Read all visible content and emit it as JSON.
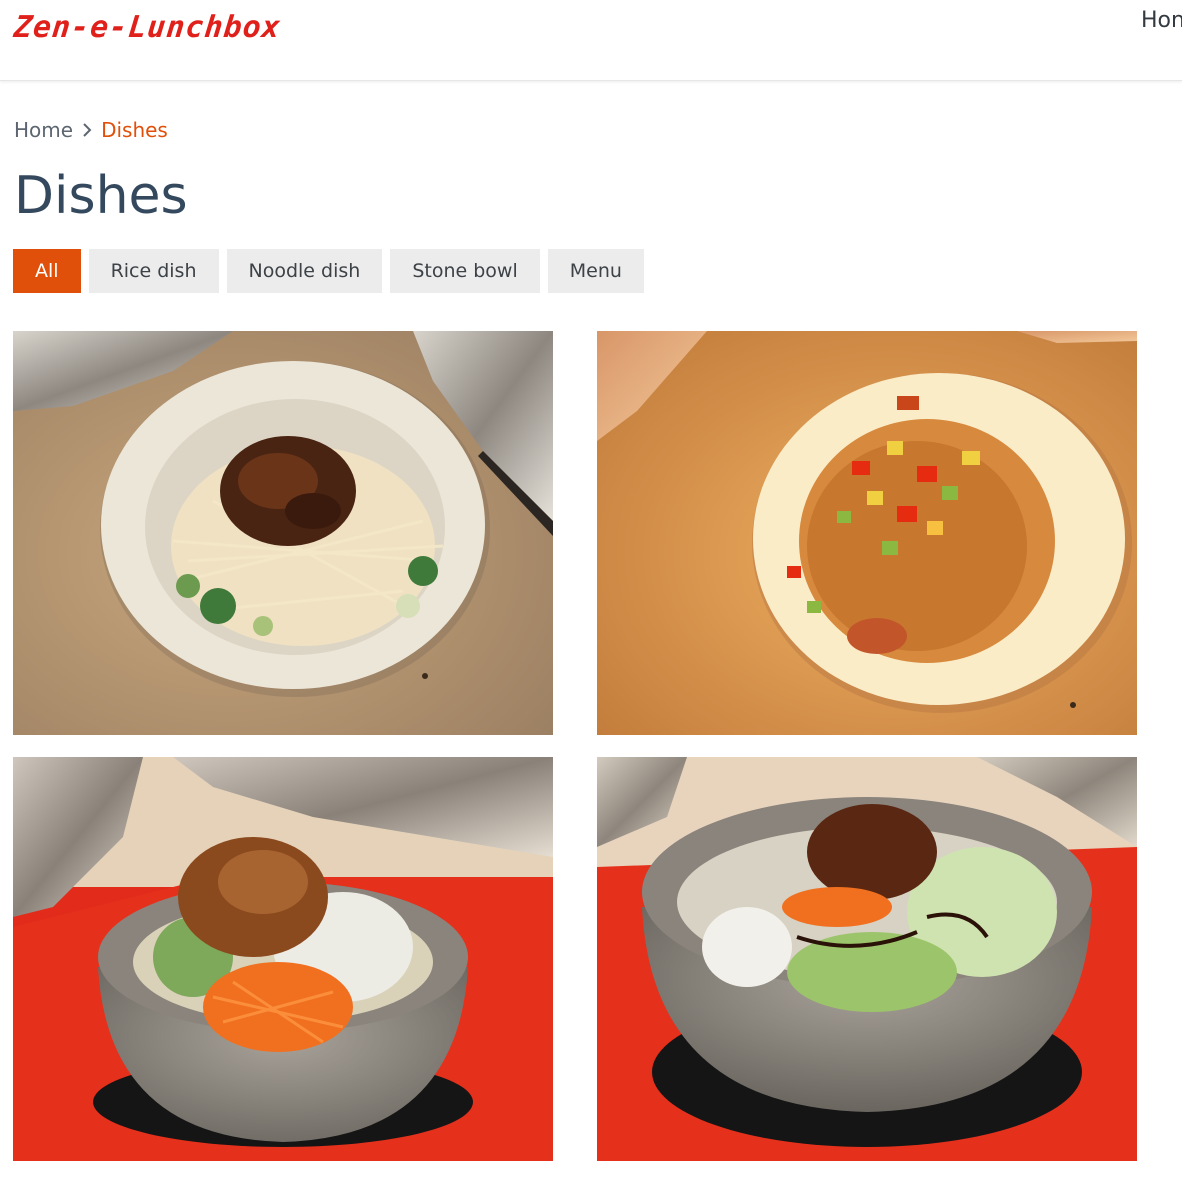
{
  "header": {
    "logo_text": "Zen-e-Lunchbox",
    "nav_partial": "Hon"
  },
  "breadcrumb": {
    "home": "Home",
    "separator": "›",
    "current": "Dishes"
  },
  "page": {
    "title": "Dishes"
  },
  "filters": [
    {
      "label": "All",
      "active": true
    },
    {
      "label": "Rice dish",
      "active": false
    },
    {
      "label": "Noodle dish",
      "active": false
    },
    {
      "label": "Stone bowl",
      "active": false
    },
    {
      "label": "Menu",
      "active": false
    }
  ],
  "colors": {
    "accent": "#e0500b",
    "logo": "#e0201a",
    "title": "#34495e",
    "filter_bg": "#ececec"
  },
  "dishes": [
    {
      "photo": "noodle-bowl-photo"
    },
    {
      "photo": "fried-rice-plate-photo"
    },
    {
      "photo": "stone-bowl-carrot-photo"
    },
    {
      "photo": "stone-bowl-rice-photo"
    }
  ]
}
